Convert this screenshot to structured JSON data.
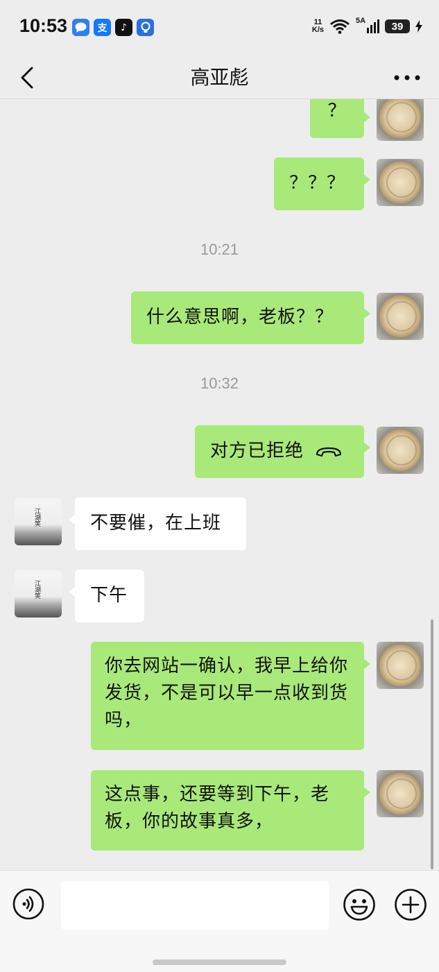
{
  "status_bar": {
    "time": "10:53",
    "app_icons": [
      {
        "name": "message-app-icon",
        "glyph": "",
        "color": "#2f7ff0"
      },
      {
        "name": "alipay-icon",
        "glyph": "支",
        "color": "#1677ff"
      },
      {
        "name": "tiktok-icon",
        "glyph": "♪",
        "color": "#111111"
      },
      {
        "name": "bulb-app-icon",
        "glyph": "",
        "color": "#2b6fe0"
      }
    ],
    "net_speed_value": "11",
    "net_speed_unit": "K/s",
    "signal_label": "5A",
    "battery": "39"
  },
  "nav": {
    "title": "高亚彪"
  },
  "messages": [
    {
      "side": "me",
      "text": "？"
    },
    {
      "side": "me",
      "text": "？？？"
    },
    {
      "type": "time",
      "text": "10:21"
    },
    {
      "side": "me",
      "text": "什么意思啊，老板？？"
    },
    {
      "type": "time",
      "text": "10:32"
    },
    {
      "side": "me",
      "text": "对方已拒绝",
      "icon": "call-declined-icon"
    },
    {
      "side": "other",
      "text": "不要催，在上班"
    },
    {
      "side": "other",
      "text": "下午"
    },
    {
      "side": "me",
      "text": "你去网站一确认，我早上给你发货，不是可以早一点收到货吗，"
    },
    {
      "side": "me",
      "text": "这点事，还要等到下午，老板，你的故事真多，"
    }
  ],
  "other_avatar_text": "江湖笑",
  "colors": {
    "my_bubble": "#a9e97a",
    "other_bubble": "#ffffff",
    "background": "#ededed"
  }
}
